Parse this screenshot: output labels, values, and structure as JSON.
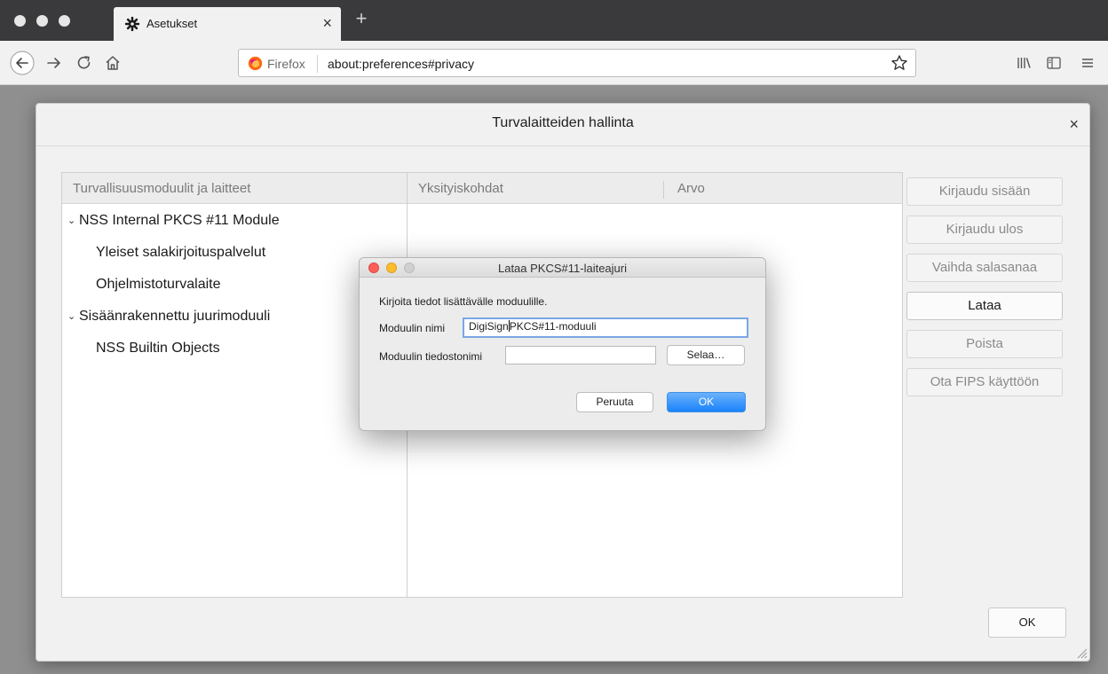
{
  "browser": {
    "tab_title": "Asetukset",
    "tab_close": "×",
    "new_tab": "+",
    "identity_label": "Firefox",
    "url": "about:preferences#privacy"
  },
  "device_manager": {
    "title": "Turvalaitteiden hallinta",
    "close": "×",
    "columns": {
      "modules": "Turvallisuusmoduulit ja laitteet",
      "details": "Yksityiskohdat",
      "value": "Arvo"
    },
    "tree": [
      {
        "label": "NSS Internal PKCS #11 Module",
        "level": 0,
        "expanded": true
      },
      {
        "label": "Yleiset salakirjoituspalvelut",
        "level": 1
      },
      {
        "label": "Ohjelmistoturvalaite",
        "level": 1
      },
      {
        "label": "Sisäänrakennettu juurimoduuli",
        "level": 0,
        "expanded": true
      },
      {
        "label": "NSS Builtin Objects",
        "level": 1
      }
    ],
    "buttons": [
      {
        "label": "Kirjaudu sisään",
        "enabled": false
      },
      {
        "label": "Kirjaudu ulos",
        "enabled": false
      },
      {
        "label": "Vaihda salasanaa",
        "enabled": false
      },
      {
        "label": "Lataa",
        "enabled": true
      },
      {
        "label": "Poista",
        "enabled": false
      },
      {
        "label": "Ota FIPS käyttöön",
        "enabled": false
      }
    ],
    "ok_label": "OK"
  },
  "load_dialog": {
    "title": "Lataa PKCS#11-laiteajuri",
    "instructions": "Kirjoita tiedot lisättävälle moduulille.",
    "module_name_label": "Moduulin nimi",
    "module_name_before_caret": "DigiSign",
    "module_name_after_caret": "PKCS#11-moduuli",
    "module_filename_label": "Moduulin tiedostonimi",
    "module_filename_value": "",
    "browse_label": "Selaa…",
    "cancel_label": "Peruuta",
    "ok_label": "OK"
  },
  "colors": {
    "primary_button": "#1a82fb",
    "mac_close": "#fc5f57",
    "mac_minimize": "#fdbc2e",
    "mac_zoom": "#d0d0d0",
    "firefox_orange": "#ff6611"
  }
}
